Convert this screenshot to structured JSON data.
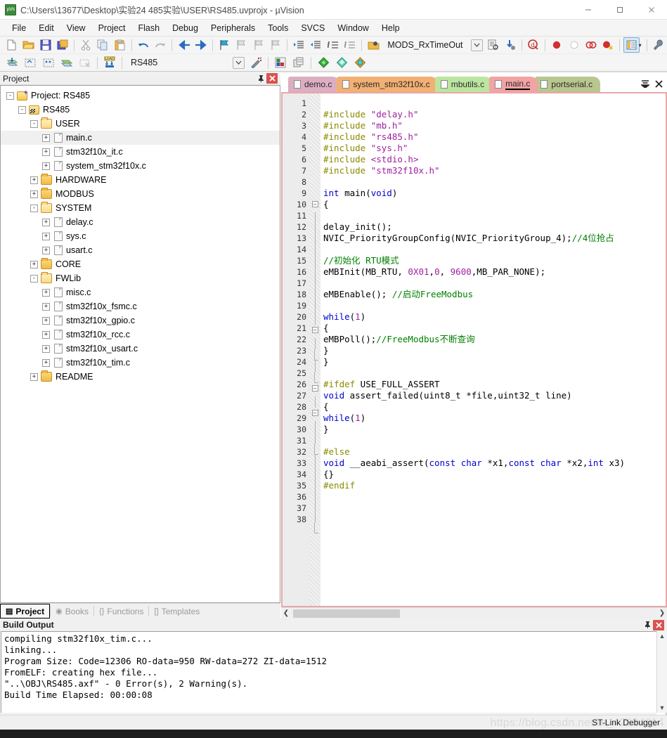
{
  "window": {
    "title": "C:\\Users\\13677\\Desktop\\实验24 485实验\\USER\\RS485.uvprojx - µVision",
    "minimize": "—",
    "maximize": "▢",
    "close": "✕"
  },
  "menu": {
    "items": [
      "File",
      "Edit",
      "View",
      "Project",
      "Flash",
      "Debug",
      "Peripherals",
      "Tools",
      "SVCS",
      "Window",
      "Help"
    ]
  },
  "toolbar1": {
    "icons": [
      "new-file-icon",
      "open-file-icon",
      "save-icon",
      "save-all-icon",
      "cut-icon",
      "copy-icon",
      "paste-icon",
      "undo-icon",
      "redo-icon",
      "navigate-back-icon",
      "navigate-forward-icon",
      "bookmark-toggle-icon",
      "bookmark-prev-icon",
      "bookmark-next-icon",
      "bookmark-clear-icon",
      "indent-icon",
      "outdent-icon",
      "comment-icon",
      "uncomment-icon"
    ]
  },
  "toolbar2": {
    "icons": [
      "build-icon",
      "rebuild-icon",
      "batch-build-icon",
      "translate-icon",
      "stop-build-icon",
      "download-icon"
    ],
    "target_value": "RS485",
    "right_icons": [
      "target-options-icon",
      "manage-components-icon",
      "configure-wizard-icon",
      "multi-project-icon",
      "debug-settings-icon",
      "flash-download-icon",
      "flash-erase-icon"
    ],
    "function_value": "MODS_RxTimeOut",
    "debug_icons": [
      "insert-breakpoint-icon",
      "disable-breakpoint-icon",
      "kill-all-breakpoints-icon",
      "disable-all-breakpoints-icon"
    ],
    "window_icon": "project-window-icon",
    "wrench_icon": "configuration-wrench-icon"
  },
  "project_pane": {
    "title": "Project",
    "pin_icon": "pin-icon",
    "close_icon": "close-icon",
    "tree": [
      {
        "label": "Project: RS485",
        "indent": 0,
        "icon": "project-icon",
        "expander": "-"
      },
      {
        "label": "RS485",
        "indent": 1,
        "icon": "target-icon",
        "expander": "-"
      },
      {
        "label": "USER",
        "indent": 2,
        "icon": "folder-open-icon",
        "expander": "-"
      },
      {
        "label": "main.c",
        "indent": 3,
        "icon": "file-icon",
        "expander": "+",
        "selected": true
      },
      {
        "label": "stm32f10x_it.c",
        "indent": 3,
        "icon": "file-icon",
        "expander": "+"
      },
      {
        "label": "system_stm32f10x.c",
        "indent": 3,
        "icon": "file-icon",
        "expander": "+"
      },
      {
        "label": "HARDWARE",
        "indent": 2,
        "icon": "folder-icon",
        "expander": "+"
      },
      {
        "label": "MODBUS",
        "indent": 2,
        "icon": "folder-icon",
        "expander": "+"
      },
      {
        "label": "SYSTEM",
        "indent": 2,
        "icon": "folder-open-icon",
        "expander": "-"
      },
      {
        "label": "delay.c",
        "indent": 3,
        "icon": "file-icon",
        "expander": "+"
      },
      {
        "label": "sys.c",
        "indent": 3,
        "icon": "file-icon",
        "expander": "+"
      },
      {
        "label": "usart.c",
        "indent": 3,
        "icon": "file-icon",
        "expander": "+"
      },
      {
        "label": "CORE",
        "indent": 2,
        "icon": "folder-icon",
        "expander": "+"
      },
      {
        "label": "FWLib",
        "indent": 2,
        "icon": "folder-open-icon",
        "expander": "-"
      },
      {
        "label": "misc.c",
        "indent": 3,
        "icon": "file-icon",
        "expander": "+"
      },
      {
        "label": "stm32f10x_fsmc.c",
        "indent": 3,
        "icon": "file-icon",
        "expander": "+"
      },
      {
        "label": "stm32f10x_gpio.c",
        "indent": 3,
        "icon": "file-icon",
        "expander": "+"
      },
      {
        "label": "stm32f10x_rcc.c",
        "indent": 3,
        "icon": "file-icon",
        "expander": "+"
      },
      {
        "label": "stm32f10x_usart.c",
        "indent": 3,
        "icon": "file-icon",
        "expander": "+"
      },
      {
        "label": "stm32f10x_tim.c",
        "indent": 3,
        "icon": "file-icon",
        "expander": "+"
      },
      {
        "label": "README",
        "indent": 2,
        "icon": "folder-icon",
        "expander": "+"
      }
    ],
    "bottom_tabs": [
      {
        "label": "Project",
        "icon": "project-window-icon",
        "active": true
      },
      {
        "label": "Books",
        "icon": "books-icon",
        "active": false
      },
      {
        "label": "Functions",
        "icon": "functions-icon",
        "active": false
      },
      {
        "label": "Templates",
        "icon": "templates-icon",
        "active": false
      }
    ]
  },
  "editor": {
    "tabs": [
      {
        "label": "demo.c",
        "color": "#ddaec2",
        "active": false
      },
      {
        "label": "system_stm32f10x.c",
        "color": "#f2b073",
        "active": false
      },
      {
        "label": "mbutils.c",
        "color": "#bce5a0",
        "active": false
      },
      {
        "label": "main.c",
        "color": "#f2a3a3",
        "active": true
      },
      {
        "label": "portserial.c",
        "color": "#b9c78f",
        "active": false
      }
    ],
    "tab_overflow_icon": "tab-list-icon",
    "tab_close_icon": "close-tab-icon",
    "lines": [
      {
        "n": 1,
        "fold": "",
        "tokens": []
      },
      {
        "n": 2,
        "fold": "",
        "tokens": [
          {
            "t": "pl",
            "s": " "
          },
          {
            "t": "pp",
            "s": "#include"
          },
          {
            "t": "pl",
            "s": " "
          },
          {
            "t": "str",
            "s": "\"delay.h\""
          }
        ]
      },
      {
        "n": 3,
        "fold": "",
        "tokens": [
          {
            "t": "pl",
            "s": " "
          },
          {
            "t": "pp",
            "s": "#include"
          },
          {
            "t": "pl",
            "s": " "
          },
          {
            "t": "str",
            "s": "\"mb.h\""
          }
        ]
      },
      {
        "n": 4,
        "fold": "",
        "tokens": [
          {
            "t": "pl",
            "s": " "
          },
          {
            "t": "pp",
            "s": "#include"
          },
          {
            "t": "pl",
            "s": " "
          },
          {
            "t": "str",
            "s": "\"rs485.h\""
          }
        ]
      },
      {
        "n": 5,
        "fold": "",
        "tokens": [
          {
            "t": "pl",
            "s": " "
          },
          {
            "t": "pp",
            "s": "#include"
          },
          {
            "t": "pl",
            "s": " "
          },
          {
            "t": "str",
            "s": "\"sys.h\""
          }
        ]
      },
      {
        "n": 6,
        "fold": "",
        "tokens": [
          {
            "t": "pl",
            "s": " "
          },
          {
            "t": "pp",
            "s": "#include"
          },
          {
            "t": "pl",
            "s": " "
          },
          {
            "t": "str",
            "s": "<stdio.h>"
          }
        ]
      },
      {
        "n": 7,
        "fold": "",
        "tokens": [
          {
            "t": "pl",
            "s": " "
          },
          {
            "t": "pp",
            "s": "#include"
          },
          {
            "t": "pl",
            "s": " "
          },
          {
            "t": "str",
            "s": "\"stm32f10x.h\""
          }
        ]
      },
      {
        "n": 8,
        "fold": "",
        "tokens": []
      },
      {
        "n": 9,
        "fold": "",
        "tokens": [
          {
            "t": "pl",
            "s": "  "
          },
          {
            "t": "kw",
            "s": "int"
          },
          {
            "t": "pl",
            "s": " main("
          },
          {
            "t": "kw",
            "s": "void"
          },
          {
            "t": "pl",
            "s": ")"
          }
        ]
      },
      {
        "n": 10,
        "fold": "minus",
        "tokens": [
          {
            "t": "pl",
            "s": " {"
          }
        ]
      },
      {
        "n": 11,
        "fold": "line",
        "tokens": []
      },
      {
        "n": 12,
        "fold": "line",
        "tokens": [
          {
            "t": "pl",
            "s": "   delay_init();"
          }
        ]
      },
      {
        "n": 13,
        "fold": "line",
        "tokens": [
          {
            "t": "pl",
            "s": "   NVIC_PriorityGroupConfig(NVIC_PriorityGroup_4);"
          },
          {
            "t": "cmt",
            "s": "//4位抢占"
          }
        ]
      },
      {
        "n": 14,
        "fold": "line",
        "tokens": []
      },
      {
        "n": 15,
        "fold": "line",
        "tokens": [
          {
            "t": "pl",
            "s": "   "
          },
          {
            "t": "cmt",
            "s": "//初始化 RTU模式"
          }
        ]
      },
      {
        "n": 16,
        "fold": "line",
        "tokens": [
          {
            "t": "pl",
            "s": "   eMBInit(MB_RTU, "
          },
          {
            "t": "num",
            "s": "0X01"
          },
          {
            "t": "pl",
            "s": ","
          },
          {
            "t": "num",
            "s": "0"
          },
          {
            "t": "pl",
            "s": ", "
          },
          {
            "t": "num",
            "s": "9600"
          },
          {
            "t": "pl",
            "s": ",MB_PAR_NONE);"
          }
        ]
      },
      {
        "n": 17,
        "fold": "line",
        "tokens": []
      },
      {
        "n": 18,
        "fold": "line",
        "tokens": [
          {
            "t": "pl",
            "s": "   eMBEnable();      "
          },
          {
            "t": "cmt",
            "s": "//启动FreeModbus"
          }
        ]
      },
      {
        "n": 19,
        "fold": "line",
        "tokens": []
      },
      {
        "n": 20,
        "fold": "line",
        "tokens": [
          {
            "t": "pl",
            "s": "   "
          },
          {
            "t": "kw",
            "s": "while"
          },
          {
            "t": "pl",
            "s": "("
          },
          {
            "t": "num",
            "s": "1"
          },
          {
            "t": "pl",
            "s": ")"
          }
        ]
      },
      {
        "n": 21,
        "fold": "minus",
        "tokens": [
          {
            "t": "pl",
            "s": "   {"
          }
        ]
      },
      {
        "n": 22,
        "fold": "line",
        "tokens": [
          {
            "t": "pl",
            "s": "     eMBPoll();"
          },
          {
            "t": "cmt",
            "s": "//FreeModbus不断查询"
          }
        ]
      },
      {
        "n": 23,
        "fold": "end",
        "tokens": [
          {
            "t": "pl",
            "s": "   }"
          }
        ]
      },
      {
        "n": 24,
        "fold": "line",
        "tokens": [
          {
            "t": "pl",
            "s": " }"
          }
        ]
      },
      {
        "n": 25,
        "fold": "end",
        "tokens": []
      },
      {
        "n": 26,
        "fold": "minus",
        "tokens": [
          {
            "t": "pp",
            "s": "#ifdef"
          },
          {
            "t": "pl",
            "s": " USE_FULL_ASSERT"
          }
        ]
      },
      {
        "n": 27,
        "fold": "line",
        "tokens": [
          {
            "t": "pl",
            "s": " "
          },
          {
            "t": "kw",
            "s": "void"
          },
          {
            "t": "pl",
            "s": " assert_failed(uint8_t *file,uint32_t line)"
          }
        ]
      },
      {
        "n": 28,
        "fold": "minus",
        "tokens": [
          {
            "t": "pl",
            "s": "{"
          }
        ]
      },
      {
        "n": 29,
        "fold": "line",
        "tokens": [
          {
            "t": "pl",
            "s": "   "
          },
          {
            "t": "kw",
            "s": "while"
          },
          {
            "t": "pl",
            "s": "("
          },
          {
            "t": "num",
            "s": "1"
          },
          {
            "t": "pl",
            "s": ")"
          }
        ]
      },
      {
        "n": 30,
        "fold": "line",
        "tokens": [
          {
            "t": "pl",
            "s": " }"
          }
        ]
      },
      {
        "n": 31,
        "fold": "end",
        "tokens": []
      },
      {
        "n": 32,
        "fold": "line",
        "tokens": [
          {
            "t": "pl",
            "s": " "
          },
          {
            "t": "pp",
            "s": "#else"
          }
        ]
      },
      {
        "n": 33,
        "fold": "line",
        "tokens": [
          {
            "t": "pl",
            "s": " "
          },
          {
            "t": "kw",
            "s": "void"
          },
          {
            "t": "pl",
            "s": " __aeabi_assert("
          },
          {
            "t": "kw",
            "s": "const"
          },
          {
            "t": "pl",
            "s": " "
          },
          {
            "t": "kw",
            "s": "char"
          },
          {
            "t": "pl",
            "s": " *x1,"
          },
          {
            "t": "kw",
            "s": "const"
          },
          {
            "t": "pl",
            "s": " "
          },
          {
            "t": "kw",
            "s": "char"
          },
          {
            "t": "pl",
            "s": " *x2,"
          },
          {
            "t": "kw",
            "s": "int"
          },
          {
            "t": "pl",
            "s": " x3)"
          }
        ]
      },
      {
        "n": 34,
        "fold": "line",
        "tokens": [
          {
            "t": "pl",
            "s": " {}"
          }
        ]
      },
      {
        "n": 35,
        "fold": "line",
        "tokens": [
          {
            "t": "pl",
            "s": " "
          },
          {
            "t": "pp",
            "s": "#endif"
          }
        ]
      },
      {
        "n": 36,
        "fold": "line",
        "tokens": []
      },
      {
        "n": 37,
        "fold": "line",
        "tokens": []
      },
      {
        "n": 38,
        "fold": "end",
        "tokens": []
      }
    ],
    "hscroll_left_icon": "scroll-left-icon",
    "hscroll_right_icon": "scroll-right-icon"
  },
  "build_output": {
    "title": "Build Output",
    "pin_icon": "pin-icon",
    "close_icon": "close-icon",
    "lines": [
      "compiling stm32f10x_tim.c...",
      "linking...",
      "Program Size: Code=12306 RO-data=950 RW-data=272 ZI-data=1512",
      "FromELF: creating hex file...",
      "\"..\\OBJ\\RS485.axf\" - 0 Error(s), 2 Warning(s).",
      "Build Time Elapsed:  00:00:08"
    ],
    "scroll_up_icon": "scroll-up-icon",
    "scroll_down_icon": "scroll-down-icon"
  },
  "statusbar": {
    "debugger": "ST-Link Debugger",
    "watermark": "https://blog.csdn.net/m_42634914"
  },
  "colors": {
    "accent_blue": "#0000d0",
    "comment_green": "#008000",
    "string_purple": "#a020a0",
    "preproc_olive": "#8b8b00",
    "tab_active": "#f2a3a3",
    "close_red": "#d9534f"
  }
}
